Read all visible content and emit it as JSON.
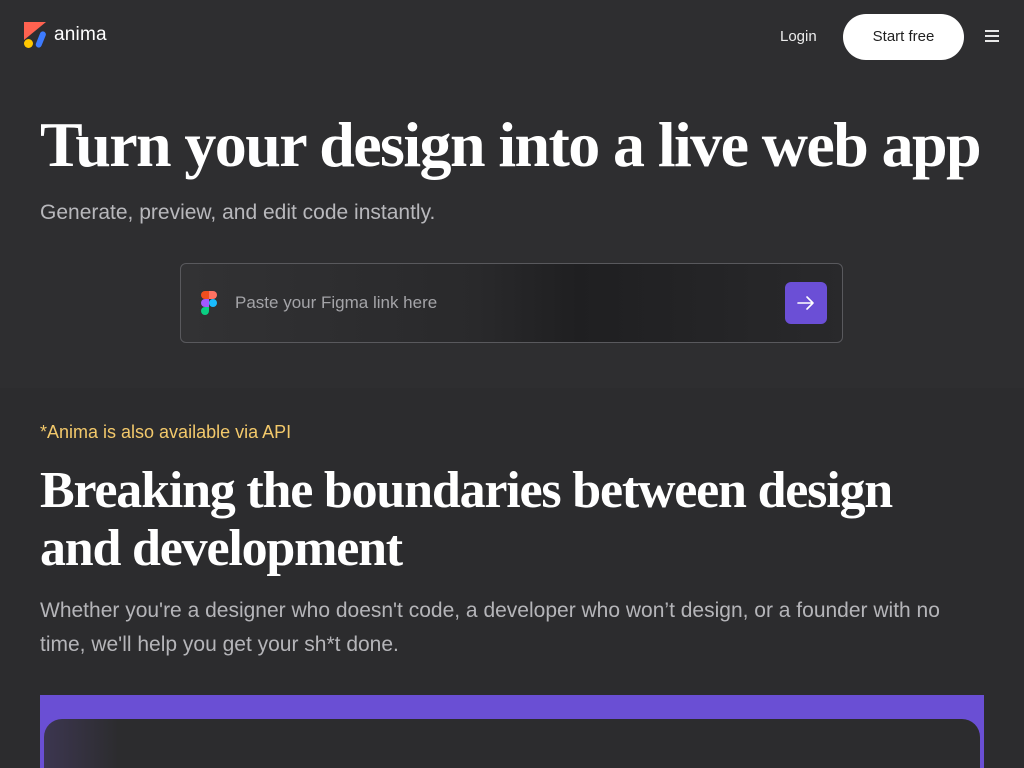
{
  "nav": {
    "brand": "anima",
    "login_label": "Login",
    "start_label": "Start free"
  },
  "hero": {
    "title": "Turn your design into a live web app",
    "subtitle": "Generate, preview, and edit code instantly.",
    "input_placeholder": "Paste your Figma link here",
    "input_value": ""
  },
  "section": {
    "api_note": "*Anima is also available via API",
    "title": "Breaking the boundaries between design and development",
    "body": "Whether you're a designer who doesn't code, a developer who won’t design, or a founder with no time, we'll help you get your sh*t done."
  },
  "colors": {
    "background": "#2c2c2e",
    "accent": "#6b4fd6",
    "api_note": "#f3c96b"
  },
  "icons": {
    "logo": "anima-logo-icon",
    "menu": "hamburger-menu-icon",
    "figma": "figma-icon",
    "submit": "arrow-right-icon"
  }
}
